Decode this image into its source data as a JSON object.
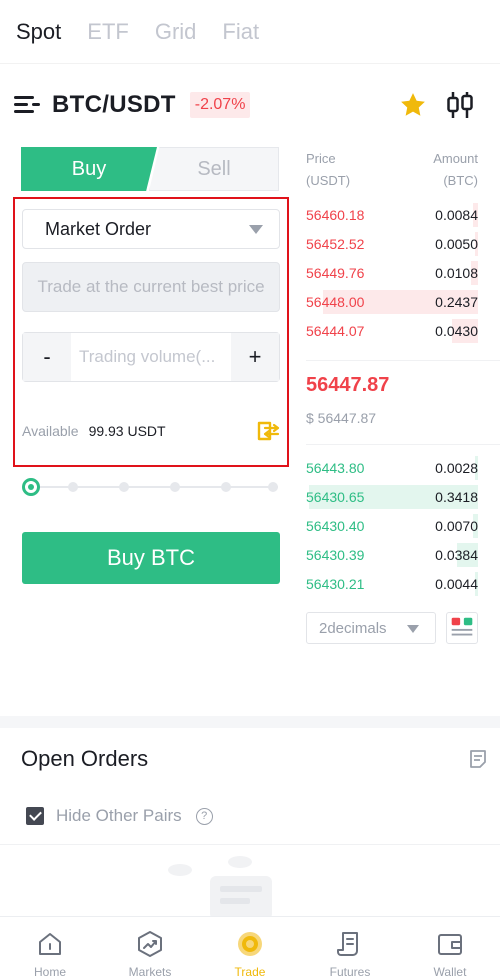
{
  "top_tabs": [
    {
      "label": "Spot",
      "active": true
    },
    {
      "label": "ETF",
      "active": false
    },
    {
      "label": "Grid",
      "active": false
    },
    {
      "label": "Fiat",
      "active": false
    }
  ],
  "pair": {
    "name": "BTC/USDT",
    "change": "-2.07%",
    "icons": [
      "menu-icon",
      "star-icon",
      "candlestick-chart-icon"
    ]
  },
  "order_form": {
    "buy_tab": "Buy",
    "sell_tab": "Sell",
    "order_type": "Market Order",
    "price_field": "Trade at the current best price",
    "volume_placeholder": "Trading volume(...",
    "minus": "-",
    "plus": "+",
    "available_label": "Available",
    "available_value": "99.93 USDT",
    "slider_percent": 0,
    "submit_label": "Buy BTC"
  },
  "order_book": {
    "price_header": "Price",
    "price_unit": "(USDT)",
    "amount_header": "Amount",
    "amount_unit": "(BTC)",
    "asks": [
      {
        "price": "56460.18",
        "amount": "0.0084",
        "depth": 0.03
      },
      {
        "price": "56452.52",
        "amount": "0.0050",
        "depth": 0.02
      },
      {
        "price": "56449.76",
        "amount": "0.0108",
        "depth": 0.04
      },
      {
        "price": "56448.00",
        "amount": "0.2437",
        "depth": 0.9
      },
      {
        "price": "56444.07",
        "amount": "0.0430",
        "depth": 0.15
      }
    ],
    "last_price": "56447.87",
    "last_price_usd": "$ 56447.87",
    "bids": [
      {
        "price": "56443.80",
        "amount": "0.0028",
        "depth": 0.02
      },
      {
        "price": "56430.65",
        "amount": "0.3418",
        "depth": 0.98
      },
      {
        "price": "56430.40",
        "amount": "0.0070",
        "depth": 0.03
      },
      {
        "price": "56430.39",
        "amount": "0.0384",
        "depth": 0.12
      },
      {
        "price": "56430.21",
        "amount": "0.0044",
        "depth": 0.02
      }
    ],
    "decimals": "2decimals"
  },
  "open_orders": {
    "title": "Open Orders",
    "hide_label": "Hide Other Pairs",
    "hide_checked": true,
    "help": "?"
  },
  "bottom_nav": [
    {
      "label": "Home",
      "icon": "home-icon",
      "active": false
    },
    {
      "label": "Markets",
      "icon": "markets-icon",
      "active": false
    },
    {
      "label": "Trade",
      "icon": "trade-icon",
      "active": true
    },
    {
      "label": "Futures",
      "icon": "futures-icon",
      "active": false
    },
    {
      "label": "Wallet",
      "icon": "wallet-icon",
      "active": false
    }
  ],
  "colors": {
    "buy_green": "#2ebd85",
    "sell_red": "#f0424a",
    "highlight_red": "#e0121a",
    "accent_yellow": "#f0b90b"
  }
}
